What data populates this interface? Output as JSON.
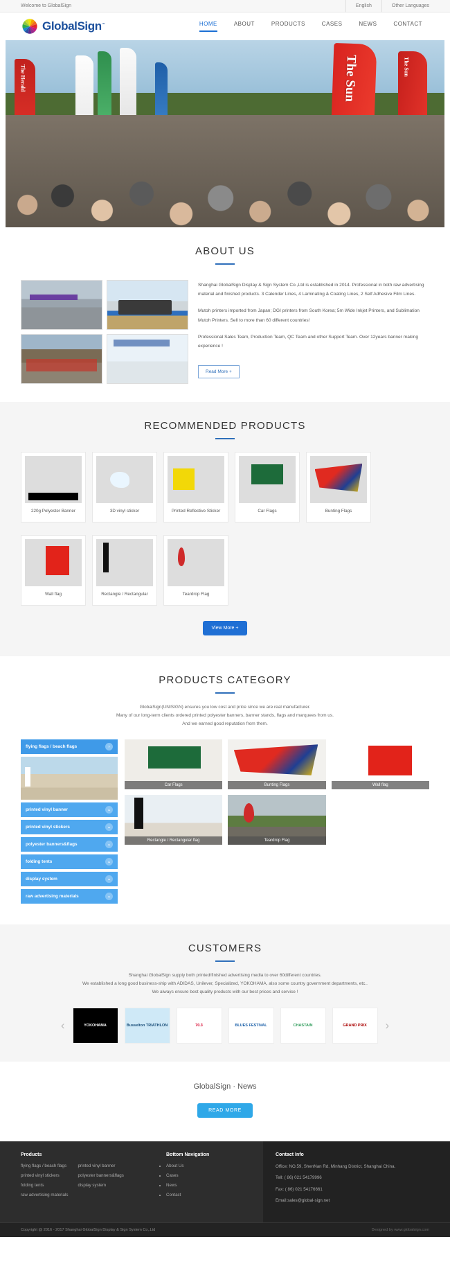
{
  "topbar": {
    "welcome": "Welcome to GlobalSign",
    "lang_primary": "English",
    "lang_other": "Other Languages"
  },
  "header": {
    "logo_text": "GlobalSign",
    "logo_tm": "™",
    "nav": [
      {
        "label": "HOME",
        "active": true
      },
      {
        "label": "ABOUT",
        "active": false
      },
      {
        "label": "PRODUCTS",
        "active": false
      },
      {
        "label": "CASES",
        "active": false
      },
      {
        "label": "NEWS",
        "active": false
      },
      {
        "label": "CONTACT",
        "active": false
      }
    ]
  },
  "hero": {
    "big_banner_text": "The Sun",
    "left_banner_text": "The Herald",
    "right_banner_text": "The Sun"
  },
  "about": {
    "title": "ABOUT US",
    "p1": "Shanghai GlobalSign Display & Sign System Co.,Ltd is established in 2014. Professional in both raw advertising material and finished products. 3 Calender Lines, 4 Laminating & Coating Lines, 2 Self Adhesive Film Lines.",
    "p2": "Mutoh printers imported from Japan; DGI printers from South Korea; 5m Wide Inkjet Printers, and Sublimation Mutoh Printers. Sell to more than 60 different countries!",
    "p3": "Professional Sales Team, Production Team, QC Team and other Support Team. Over 12years banner making experience !",
    "read_more": "Read More +"
  },
  "recommended": {
    "title": "RECOMMENDED PRODUCTS",
    "view_more": "View More +",
    "items": [
      {
        "label": "220g Polyester Banner",
        "thumb": "t-banner"
      },
      {
        "label": "3D vinyl sticker",
        "thumb": "t-3d"
      },
      {
        "label": "Printed Reflective Sticker",
        "thumb": "t-refl"
      },
      {
        "label": "Car Flags",
        "thumb": "t-car"
      },
      {
        "label": "Bunting Flags",
        "thumb": "t-bunt"
      },
      {
        "label": "Wall flag",
        "thumb": "t-wall"
      },
      {
        "label": "Rectangle / Rectangular",
        "thumb": "t-rect"
      },
      {
        "label": "Teardrop Flag",
        "thumb": "t-tear"
      }
    ]
  },
  "category": {
    "title": "PRODUCTS CATEGORY",
    "desc_line1": "GlobalSign(UNISIGN) ensures you low cost and price since we are real manufacturer.",
    "desc_line2": "Many of our long-term clients ordered printed polyester banners, banner stands, flags and marquees from us.",
    "desc_line3": "And we earned good reputation from them.",
    "list": [
      {
        "label": "flying flags / beach flags",
        "icon": "chevron-right-icon",
        "active": true
      },
      {
        "label": "printed vinyl banner",
        "icon": "chevron-down-icon",
        "active": false
      },
      {
        "label": "printed vinyl stickers",
        "icon": "chevron-down-icon",
        "active": false
      },
      {
        "label": "polyester banners&flags",
        "icon": "chevron-down-icon",
        "active": false
      },
      {
        "label": "folding tents",
        "icon": "chevron-down-icon",
        "active": false
      },
      {
        "label": "display system",
        "icon": "chevron-down-icon",
        "active": false
      },
      {
        "label": "raw advertising materials",
        "icon": "chevron-down-icon",
        "active": false
      }
    ],
    "grid": [
      {
        "label": "Car Flags",
        "thumb": "cc-car"
      },
      {
        "label": "Bunting Flags",
        "thumb": "cc-bunt"
      },
      {
        "label": "Wall flag",
        "thumb": "cc-wall"
      },
      {
        "label": "Rectangle / Rectangular flag",
        "thumb": "cc-rect"
      },
      {
        "label": "Teardrop Flag",
        "thumb": "cc-tear"
      }
    ]
  },
  "customers": {
    "title": "CUSTOMERS",
    "desc_line1": "Shanghai GlobalSign supply both printed/finished advertising media to over 60different countries.",
    "desc_line2": "We established a long good business-ship with ADIDAS, Unilever, Specialized, YOKOHAMA, also some country government departments, etc..",
    "desc_line3": "We always ensure best quality products with our best prices and service !",
    "prev_arrow": "‹",
    "next_arrow": "›",
    "logos": [
      {
        "name": "YOKOHAMA",
        "cls": "cl-yoko"
      },
      {
        "name": "Busselton TRIATHLON",
        "cls": "cl-buss"
      },
      {
        "name": "70.3",
        "cls": "cl-703"
      },
      {
        "name": "BLUES FESTIVAL",
        "cls": "cl-blues"
      },
      {
        "name": "CHASTAIN",
        "cls": "cl-chas"
      },
      {
        "name": "GRAND PRIX",
        "cls": "cl-gp"
      }
    ]
  },
  "news": {
    "title": "GlobalSign · News",
    "button": "READ MORE"
  },
  "footer": {
    "products_title": "Products",
    "products_col1": [
      "flying flags / beach flags",
      "printed vinyl stickers",
      "folding tents",
      "raw advertising materials"
    ],
    "products_col2": [
      "printed vinyl banner",
      "polyester banners&flags",
      "display system"
    ],
    "nav_title": "Bottom Navigation",
    "nav_items": [
      "About Us",
      "Cases",
      "News",
      "Contact"
    ],
    "contact_title": "Contact Info",
    "contact_office": "Office: NO.59, ShenNan Rd, Minhang District, Shanghai China.",
    "contact_tell": "Tell: ( 86) 021 54179996",
    "contact_fax": "Fax: ( 86) 021 54176661",
    "contact_email": "Email:sales@global-sign.net",
    "copyright": "Copyright @ 2016 - 2017 Shanghai GlobalSign Display & Sign System Co,.Ltd",
    "designed_by": "Designed by www.globalsign.com"
  },
  "colors": {
    "brand_blue": "#1b4f9c",
    "accent_blue": "#1f6fd4",
    "cat_blue": "#4fa8ef",
    "news_blue": "#2fa8e8",
    "footer_dark": "#2d2d2d"
  }
}
